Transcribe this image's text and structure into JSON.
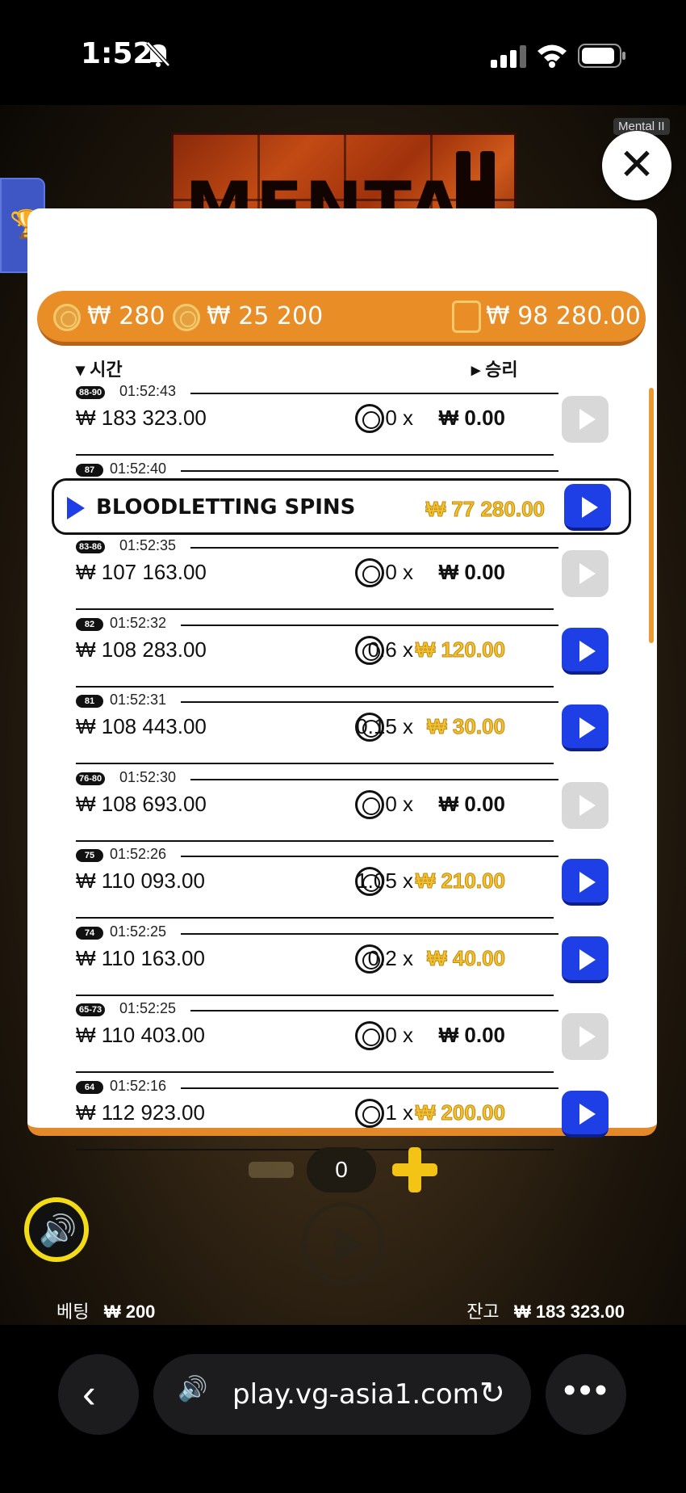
{
  "status": {
    "time": "1:52"
  },
  "app": {
    "logo_text": "MENTAL",
    "tooltip": "Mental II",
    "close_glyph": "✕"
  },
  "header": {
    "coin1_value": "₩ 280",
    "coin2_value": "₩ 25 200",
    "wallet_value": "₩ 98 280.00"
  },
  "columns": {
    "time": "▾ 시간",
    "win": "▸ 승리"
  },
  "rows": [
    {
      "badge": "88-90",
      "time": "01:52:43",
      "balance": "₩ 183 323.00",
      "mult": "0 x",
      "win": "₩ 0.00",
      "win_style": "zero",
      "play_active": false
    },
    {
      "badge": "87",
      "time": "01:52:40",
      "bonus_label": "BLOODLETTING SPINS",
      "win": "₩ 77 280.00",
      "win_style": "gold",
      "play_active": true
    },
    {
      "badge": "83-86",
      "time": "01:52:35",
      "balance": "₩ 107 163.00",
      "mult": "0 x",
      "win": "₩ 0.00",
      "win_style": "zero",
      "play_active": false
    },
    {
      "badge": "82",
      "time": "01:52:32",
      "balance": "₩ 108 283.00",
      "mult": "0.6 x",
      "win": "₩ 120.00",
      "win_style": "gold",
      "play_active": true
    },
    {
      "badge": "81",
      "time": "01:52:31",
      "balance": "₩ 108 443.00",
      "mult": "0.15 x",
      "win": "₩ 30.00",
      "win_style": "gold",
      "play_active": true
    },
    {
      "badge": "76-80",
      "time": "01:52:30",
      "balance": "₩ 108 693.00",
      "mult": "0 x",
      "win": "₩ 0.00",
      "win_style": "zero",
      "play_active": false
    },
    {
      "badge": "75",
      "time": "01:52:26",
      "balance": "₩ 110 093.00",
      "mult": "1.05 x",
      "win": "₩ 210.00",
      "win_style": "gold",
      "play_active": true
    },
    {
      "badge": "74",
      "time": "01:52:25",
      "balance": "₩ 110 163.00",
      "mult": "0.2 x",
      "win": "₩ 40.00",
      "win_style": "gold",
      "play_active": true
    },
    {
      "badge": "65-73",
      "time": "01:52:25",
      "balance": "₩ 110 403.00",
      "mult": "0 x",
      "win": "₩ 0.00",
      "win_style": "zero",
      "play_active": false
    },
    {
      "badge": "64",
      "time": "01:52:16",
      "balance": "₩ 112 923.00",
      "mult": "1 x",
      "win": "₩ 200.00",
      "win_style": "gold",
      "play_active": true
    }
  ],
  "controls": {
    "stake_value": "0",
    "bet_label": "베팅",
    "bet_value": "₩ 200",
    "balance_label": "잔고",
    "balance_value": "₩ 183 323.00"
  },
  "browser": {
    "url": "play.vg-asia1.com",
    "back_glyph": "‹",
    "reload_glyph": "↻",
    "more_glyph": "•••"
  },
  "colors": {
    "accent_orange": "#e98d27",
    "play_blue": "#1e3fe6",
    "win_gold": "#f2c230"
  }
}
